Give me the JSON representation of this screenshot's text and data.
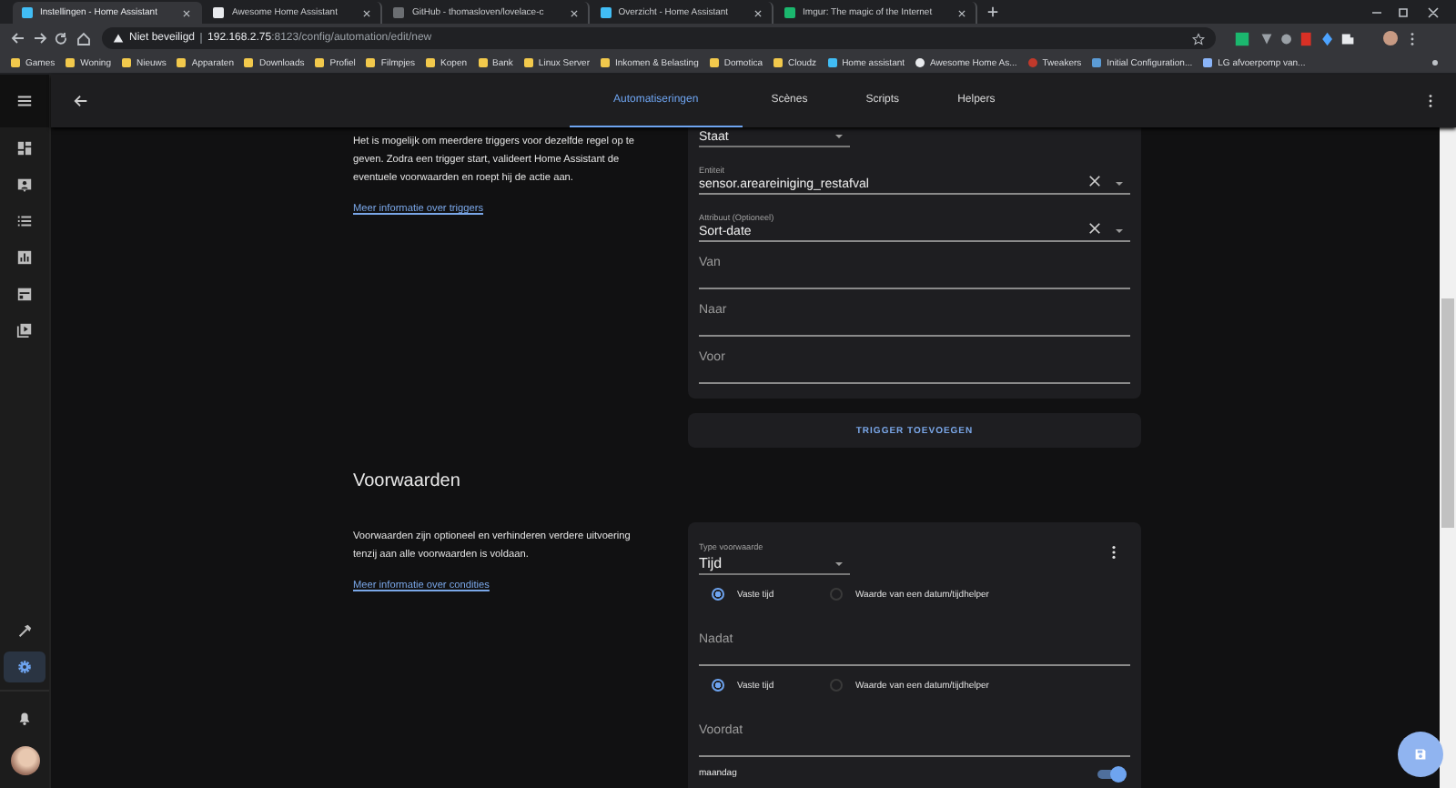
{
  "browser": {
    "tabs": [
      {
        "title": "Instellingen - Home Assistant",
        "kind": "ha",
        "selected": true
      },
      {
        "title": "Awesome Home Assistant",
        "kind": "star",
        "selected": false
      },
      {
        "title": "GitHub - thomasloven/lovelace-c",
        "kind": "github",
        "selected": false
      },
      {
        "title": "Overzicht - Home Assistant",
        "kind": "ha",
        "selected": false
      },
      {
        "title": "Imgur: The magic of the Internet",
        "kind": "imgur",
        "selected": false
      }
    ],
    "security": "Niet beveiligd",
    "host": "192.168.2.75",
    "path": ":8123/config/automation/edit/new",
    "bookmarks": [
      {
        "label": "Games",
        "kind": "folder"
      },
      {
        "label": "Woning",
        "kind": "folder"
      },
      {
        "label": "Nieuws",
        "kind": "folder"
      },
      {
        "label": "Apparaten",
        "kind": "folder"
      },
      {
        "label": "Downloads",
        "kind": "folder"
      },
      {
        "label": "Profiel",
        "kind": "folder"
      },
      {
        "label": "Filmpjes",
        "kind": "folder"
      },
      {
        "label": "Kopen",
        "kind": "folder"
      },
      {
        "label": "Bank",
        "kind": "folder"
      },
      {
        "label": "Linux Server",
        "kind": "folder"
      },
      {
        "label": "Inkomen & Belasting",
        "kind": "folder"
      },
      {
        "label": "Domotica",
        "kind": "folder"
      },
      {
        "label": "Cloudz",
        "kind": "folder"
      },
      {
        "label": "Home assistant",
        "kind": "ha"
      },
      {
        "label": "Awesome Home As...",
        "kind": "star"
      },
      {
        "label": "Tweakers",
        "kind": "round"
      },
      {
        "label": "Initial Configuration...",
        "kind": "page"
      },
      {
        "label": "LG afvoerpomp van...",
        "kind": "tool"
      }
    ]
  },
  "sidebar": {
    "items": [
      {
        "kind": "dashboard",
        "selected": false
      },
      {
        "kind": "person",
        "selected": false
      },
      {
        "kind": "list",
        "selected": false
      },
      {
        "kind": "chart",
        "selected": false
      },
      {
        "kind": "calendar",
        "selected": false
      },
      {
        "kind": "media",
        "selected": false
      }
    ],
    "bottom": [
      {
        "kind": "hammer",
        "selected": false
      },
      {
        "kind": "settings",
        "selected": true
      }
    ]
  },
  "header": {
    "tabs": [
      {
        "label": "Automatiseringen",
        "selected": true
      },
      {
        "label": "Scènes",
        "selected": false
      },
      {
        "label": "Scripts",
        "selected": false
      },
      {
        "label": "Helpers",
        "selected": false
      }
    ]
  },
  "triggers": {
    "description": "Het is mogelijk om meerdere triggers voor dezelfde regel op te geven. Zodra een trigger start, valideert Home Assistant de eventuele voorwaarden en roept hij de actie aan.",
    "link": "Meer informatie over triggers",
    "fields": [
      {
        "kind": "select",
        "value": "Staat"
      },
      {
        "kind": "combo",
        "label": "Entiteit",
        "value": "sensor.areareiniging_restafval"
      },
      {
        "kind": "combo",
        "label": "Attribuut (Optioneel)",
        "value": "Sort-date"
      },
      {
        "kind": "text",
        "placeholder": "Van"
      },
      {
        "kind": "text",
        "placeholder": "Naar"
      },
      {
        "kind": "text",
        "placeholder": "Voor"
      }
    ],
    "add_button": "TRIGGER TOEVOEGEN"
  },
  "conditions": {
    "title": "Voorwaarden",
    "description": "Voorwaarden zijn optioneel en verhinderen verdere uitvoering tenzij aan alle voorwaarden is voldaan.",
    "link": "Meer informatie over condities",
    "type_label": "Type voorwaarde",
    "type_value": "Tijd",
    "fields": [
      {
        "kind": "radio",
        "options": [
          {
            "label": "Vaste tijd",
            "selected": true
          },
          {
            "label": "Waarde van een datum/tijdhelper",
            "selected": false
          }
        ]
      },
      {
        "kind": "text",
        "placeholder": "Nadat"
      },
      {
        "kind": "radio",
        "options": [
          {
            "label": "Vaste tijd",
            "selected": true
          },
          {
            "label": "Waarde van een datum/tijdhelper",
            "selected": false
          }
        ]
      },
      {
        "kind": "text",
        "placeholder": "Voordat"
      },
      {
        "kind": "toggle",
        "label": "maandag",
        "on": true
      }
    ]
  }
}
